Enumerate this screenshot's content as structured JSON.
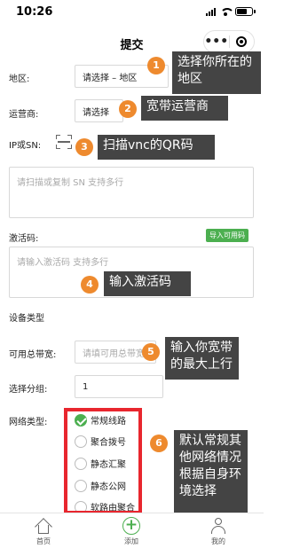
{
  "status_bar": {
    "time": "10:26"
  },
  "nav": {
    "title": "提交"
  },
  "form": {
    "region": {
      "label": "地区:",
      "value": "请选择 – 地区"
    },
    "isp": {
      "label": "运营商:",
      "value": "请选择"
    },
    "sn": {
      "label": "IP或SN:",
      "placeholder": "请扫描或复制 SN 支持多行"
    },
    "activation": {
      "label": "激活码:",
      "import_button": "导入可用码",
      "placeholder": "请输入激活码 支持多行"
    },
    "device_type": {
      "label": "设备类型"
    },
    "bandwidth": {
      "label": "可用总带宽:",
      "placeholder": "请填可用总带宽"
    },
    "group": {
      "label": "选择分组:",
      "value": "1"
    },
    "network_type": {
      "label": "网络类型:",
      "options": [
        {
          "label": "常规线路",
          "checked": true
        },
        {
          "label": "聚合拨号",
          "checked": false
        },
        {
          "label": "静态汇聚",
          "checked": false
        },
        {
          "label": "静态公网",
          "checked": false
        },
        {
          "label": "软路由聚合",
          "checked": false
        }
      ]
    }
  },
  "annotations": [
    {
      "number": "1",
      "text": "选择你所在的地区"
    },
    {
      "number": "2",
      "text": "宽带运营商"
    },
    {
      "number": "3",
      "text": "扫描vnc的QR码"
    },
    {
      "number": "4",
      "text": "输入激活码"
    },
    {
      "number": "5",
      "text": "输入你宽带的最大上行"
    },
    {
      "number": "6",
      "text": "默认常规其他网络情况根据自身环境选择"
    }
  ],
  "tabbar": {
    "items": [
      {
        "label": "首页",
        "icon": "home-icon"
      },
      {
        "label": "添加",
        "icon": "add-icon"
      },
      {
        "label": "我的",
        "icon": "profile-icon"
      }
    ]
  },
  "colors": {
    "accent": "#4caf50",
    "badge": "#ee8a2e",
    "tooltip": "#444444",
    "highlight_box": "#e8262e"
  }
}
